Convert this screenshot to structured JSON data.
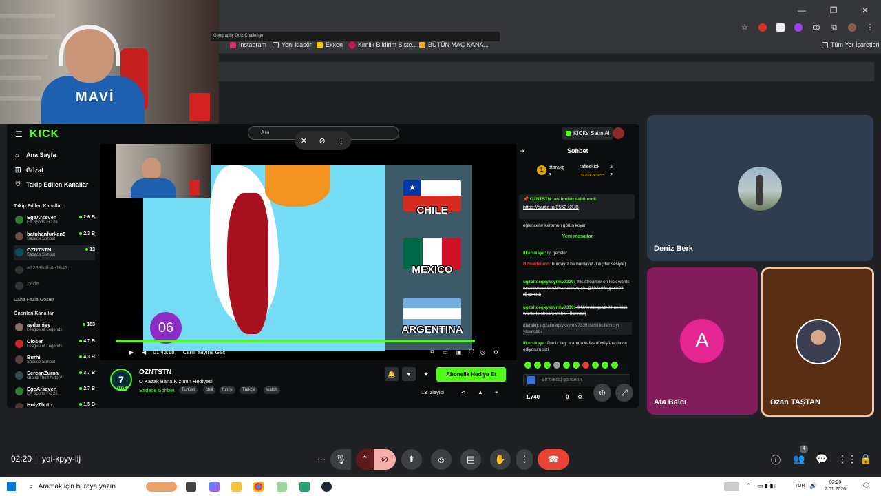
{
  "browser": {
    "bookmarks": [
      "Instagram",
      "Yeni klasör",
      "Exxen",
      "Kimlik Bildirim Siste...",
      "BÜTÜN MAÇ KANA..."
    ],
    "all_bookmarks": "Tüm Yer İşaretleri",
    "window_controls": [
      "—",
      "❐",
      "✕"
    ]
  },
  "webcam": {
    "shirt_text": "MAVİ"
  },
  "kick": {
    "logo": "KICK",
    "search_placeholder": "Ara",
    "kicks_button": "KICKs Satın Al",
    "nav": [
      "Ana Sayfa",
      "Gözat",
      "Takip Edilen Kanallar"
    ],
    "followed_title": "Takip Edilen Kanallar",
    "followed": [
      {
        "name": "EgeArseven",
        "game": "EA Sports FC 26",
        "viewers": "2,6 B",
        "color": "#2e7d32"
      },
      {
        "name": "batuhanfurkan5",
        "game": "Sadece Sohbet",
        "viewers": "2,3 B",
        "color": "#6d4c41"
      },
      {
        "name": "OZNTSTN",
        "game": "Sadece Sohbet",
        "viewers": "13",
        "color": "#0e4d57"
      }
    ],
    "followed_offline": [
      "a2209b8b4e1643...",
      " Zade"
    ],
    "show_more": "Daha Fazla Göster",
    "recommended_title": "Önerilen Kanallar",
    "recommended": [
      {
        "name": "aydamiyy",
        "game": "League of Legends",
        "viewers": "183",
        "color": "#8d6e63"
      },
      {
        "name": "Closer",
        "game": "League of Legends",
        "viewers": "4,7 B",
        "color": "#c62828"
      },
      {
        "name": "Burhi",
        "game": "Sadece Sohbet",
        "viewers": "4,3 B",
        "color": "#5d4037"
      },
      {
        "name": "SercanZurna",
        "game": "Grand Theft Auto V",
        "viewers": "3,7 B",
        "color": "#37474f"
      },
      {
        "name": "EgeArseven",
        "game": "EA Sports FC 26",
        "viewers": "2,7 B",
        "color": "#2e7d32"
      },
      {
        "name": "HolyThoth",
        "game": "",
        "viewers": "1,5 B",
        "color": "#4e342e"
      }
    ],
    "player": {
      "quiz_title": "Geography Quiz Challenge",
      "countries": [
        "CHILE",
        "MEXICO",
        "ARGENTINA"
      ],
      "timer": "06",
      "time": "01:43:18",
      "live_link": "Canlı Yayına Geç"
    },
    "channel": {
      "logo_letter": "7",
      "live": "LIVE",
      "name": "OZNTSTN",
      "title": "O Kazak Bana Kızımın Hediyesi",
      "category": "Sadece Sohbet",
      "tags": [
        "Turkish",
        "chill",
        "funny",
        "Türkçe",
        "watch"
      ],
      "subscribe_button": "Abonelik Hediye Et",
      "viewers": "13 İzleyici"
    },
    "chat": {
      "title": "Sohbet",
      "leaders": [
        {
          "rank": "1",
          "name": "dtarakg",
          "count": "3"
        },
        {
          "rank": "",
          "name": "rafieskick",
          "count": "2"
        },
        {
          "rank": "",
          "name": "musicamee",
          "count": "2"
        }
      ],
      "pinned_by": "OZNTSTN tarafından sabitlendi",
      "pinned_link": "https://gartic.io/0552+2UB",
      "old_line": "eğlenceler kartonun götün koyim",
      "new_messages": "Yeni mesajlar",
      "messages": [
        {
          "user": "ilkerukaya:",
          "text": " iyi geceler"
        },
        {
          "user": "B2medelenn:",
          "text": " burdayız be burdayız (kılıçdar sesiyle)"
        },
        {
          "user": "ugzaitoeqxyksyrmv7339:",
          "text": " this streamer on kick wants to stream with u his username is @Unlinkingpath93 (Banned)"
        },
        {
          "user": "ugzaitoeqxyksyrmv7339:",
          "text": " @Unlinkingpath93 on kick wants to stream with u (Banned)"
        },
        {
          "user": "",
          "text": "dtarakg, ugzaitoeqxyksyrmv7339 isimli kullanıcıyı yasakladı"
        },
        {
          "user": "ilkerukaya:",
          "text": " Deniz bey aramda kafes dövüşüne davet ediyorum sizi"
        }
      ],
      "input_placeholder": "Bir mesaj gönderin",
      "balance": "1.740",
      "balance2": "0"
    }
  },
  "meet": {
    "participants": [
      {
        "name": "Deniz Berk"
      },
      {
        "name": "Ata Balcı",
        "initial": "A"
      },
      {
        "name": "Ozan TAŞTAN"
      }
    ],
    "time": "02:20",
    "code": "yqi-kpyy-iij",
    "people_count": "4"
  },
  "taskbar": {
    "search": "Aramak için buraya yazın",
    "lang": "TUR",
    "time": "02:20",
    "date": "7.01.2026"
  },
  "colors": {
    "kick_green": "#53fc18",
    "end_call": "#ea4335",
    "meet_bg": "#202124"
  }
}
